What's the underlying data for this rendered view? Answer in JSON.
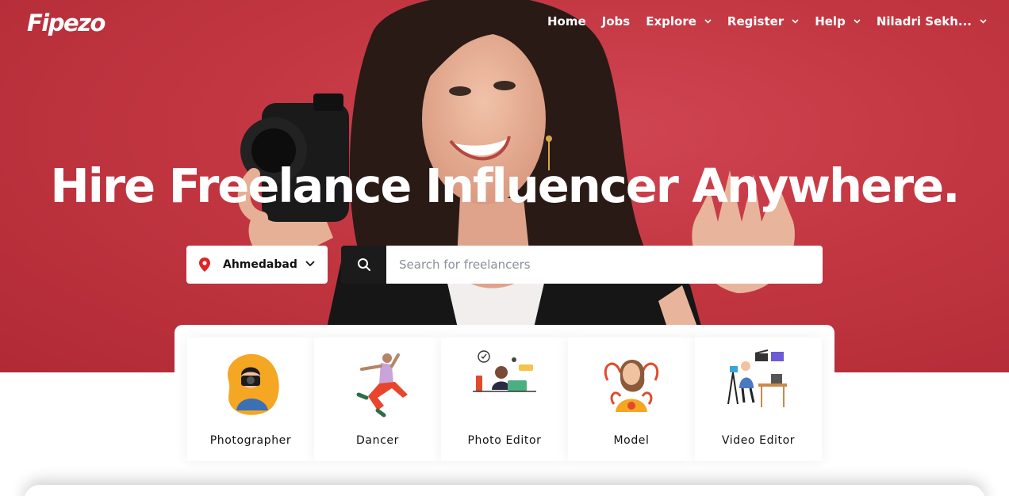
{
  "brand": {
    "logo": "Fipezo"
  },
  "nav": {
    "items": [
      {
        "label": "Home",
        "dropdown": false
      },
      {
        "label": "Jobs",
        "dropdown": false
      },
      {
        "label": "Explore",
        "dropdown": true
      },
      {
        "label": "Register",
        "dropdown": true
      },
      {
        "label": "Help",
        "dropdown": true
      },
      {
        "label": "Niladri Sekh...",
        "dropdown": true
      }
    ]
  },
  "hero": {
    "headline": "Hire Freelance Influencer Anywhere."
  },
  "search": {
    "location": "Ahmedabad",
    "placeholder": "Search for freelancers",
    "value": ""
  },
  "categories": [
    {
      "label": "Photographer",
      "icon": "photographer-illustration"
    },
    {
      "label": "Dancer",
      "icon": "dancer-illustration"
    },
    {
      "label": "Photo Editor",
      "icon": "photo-editor-illustration"
    },
    {
      "label": "Model",
      "icon": "model-illustration"
    },
    {
      "label": "Video Editor",
      "icon": "video-editor-illustration"
    }
  ],
  "colors": {
    "hero_red": "#c23641",
    "pin_red": "#e02424",
    "search_button": "#1b1b1b",
    "text_dark": "#111111"
  }
}
